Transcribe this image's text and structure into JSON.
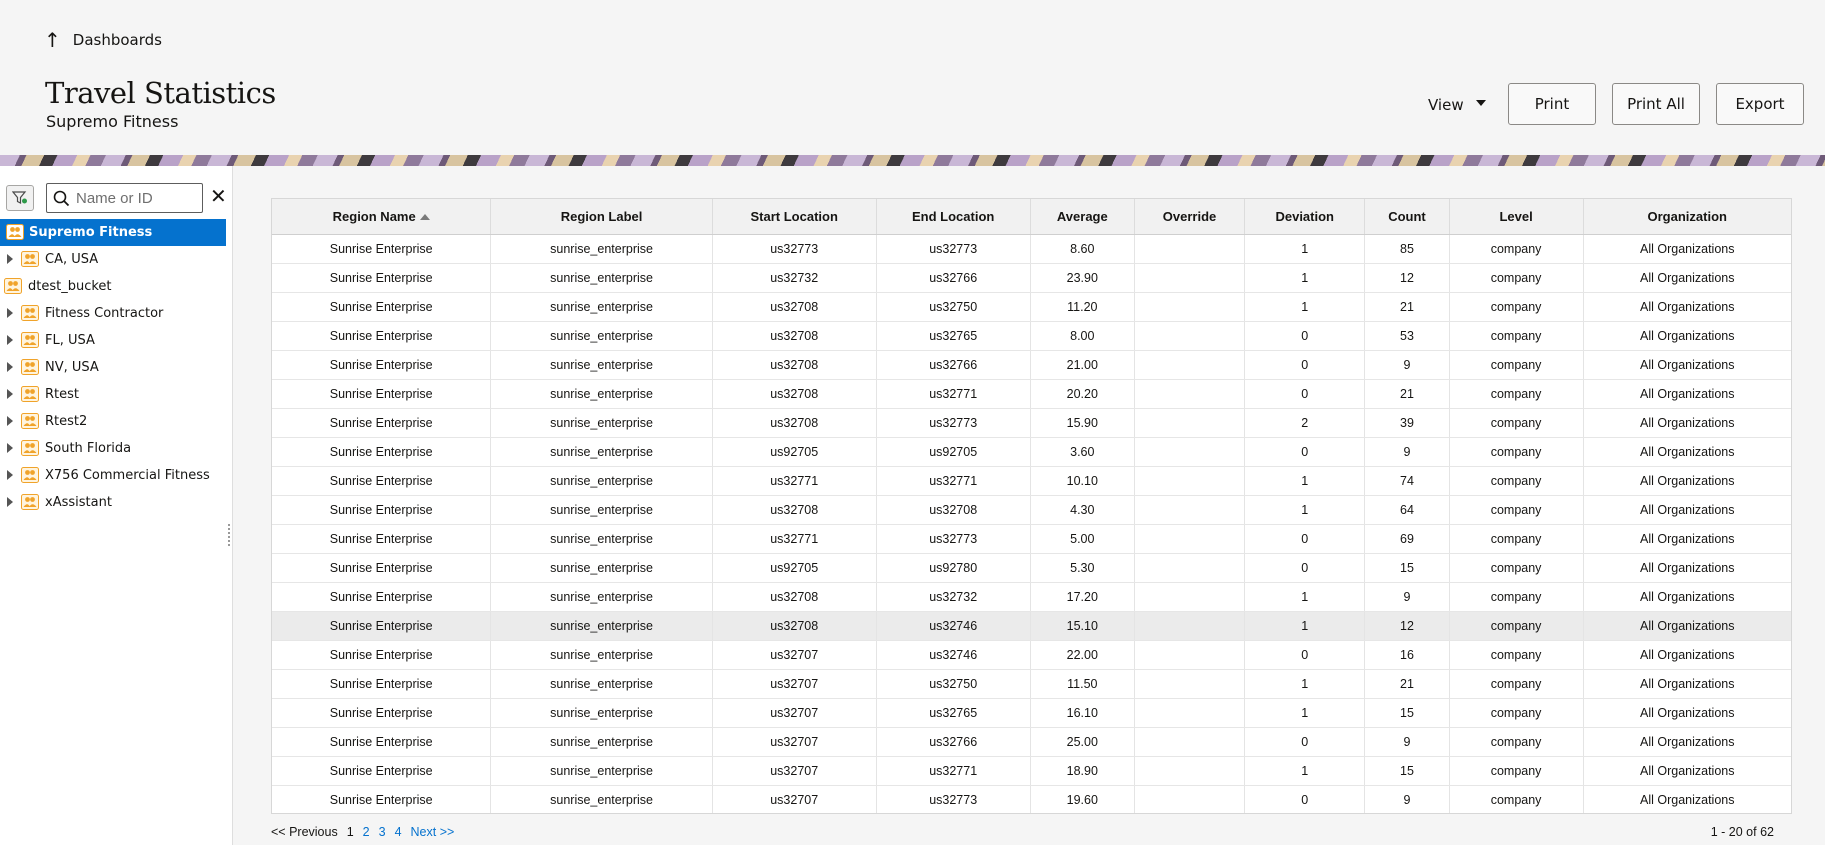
{
  "header": {
    "back_label": "Dashboards",
    "title": "Travel Statistics",
    "subtitle": "Supremo Fitness",
    "view_label": "View",
    "print_label": "Print",
    "print_all_label": "Print All",
    "export_label": "Export"
  },
  "sidebar": {
    "search_placeholder": "Name or ID",
    "items": [
      {
        "label": "Supremo Fitness"
      },
      {
        "label": "CA, USA"
      },
      {
        "label": "dtest_bucket"
      },
      {
        "label": "Fitness Contractor"
      },
      {
        "label": "FL, USA"
      },
      {
        "label": "NV, USA"
      },
      {
        "label": "Rtest"
      },
      {
        "label": "Rtest2"
      },
      {
        "label": "South Florida"
      },
      {
        "label": "X756 Commercial Fitness"
      },
      {
        "label": "xAssistant"
      }
    ]
  },
  "table": {
    "columns": [
      "Region Name",
      "Region Label",
      "Start Location",
      "End Location",
      "Average",
      "Override",
      "Deviation",
      "Count",
      "Level",
      "Organization"
    ],
    "rows": [
      [
        "Sunrise Enterprise",
        "sunrise_enterprise",
        "us32773",
        "us32773",
        "8.60",
        "",
        "1",
        "85",
        "company",
        "All Organizations"
      ],
      [
        "Sunrise Enterprise",
        "sunrise_enterprise",
        "us32732",
        "us32766",
        "23.90",
        "",
        "1",
        "12",
        "company",
        "All Organizations"
      ],
      [
        "Sunrise Enterprise",
        "sunrise_enterprise",
        "us32708",
        "us32750",
        "11.20",
        "",
        "1",
        "21",
        "company",
        "All Organizations"
      ],
      [
        "Sunrise Enterprise",
        "sunrise_enterprise",
        "us32708",
        "us32765",
        "8.00",
        "",
        "0",
        "53",
        "company",
        "All Organizations"
      ],
      [
        "Sunrise Enterprise",
        "sunrise_enterprise",
        "us32708",
        "us32766",
        "21.00",
        "",
        "0",
        "9",
        "company",
        "All Organizations"
      ],
      [
        "Sunrise Enterprise",
        "sunrise_enterprise",
        "us32708",
        "us32771",
        "20.20",
        "",
        "0",
        "21",
        "company",
        "All Organizations"
      ],
      [
        "Sunrise Enterprise",
        "sunrise_enterprise",
        "us32708",
        "us32773",
        "15.90",
        "",
        "2",
        "39",
        "company",
        "All Organizations"
      ],
      [
        "Sunrise Enterprise",
        "sunrise_enterprise",
        "us92705",
        "us92705",
        "3.60",
        "",
        "0",
        "9",
        "company",
        "All Organizations"
      ],
      [
        "Sunrise Enterprise",
        "sunrise_enterprise",
        "us32771",
        "us32771",
        "10.10",
        "",
        "1",
        "74",
        "company",
        "All Organizations"
      ],
      [
        "Sunrise Enterprise",
        "sunrise_enterprise",
        "us32708",
        "us32708",
        "4.30",
        "",
        "1",
        "64",
        "company",
        "All Organizations"
      ],
      [
        "Sunrise Enterprise",
        "sunrise_enterprise",
        "us32771",
        "us32773",
        "5.00",
        "",
        "0",
        "69",
        "company",
        "All Organizations"
      ],
      [
        "Sunrise Enterprise",
        "sunrise_enterprise",
        "us92705",
        "us92780",
        "5.30",
        "",
        "0",
        "15",
        "company",
        "All Organizations"
      ],
      [
        "Sunrise Enterprise",
        "sunrise_enterprise",
        "us32708",
        "us32732",
        "17.20",
        "",
        "1",
        "9",
        "company",
        "All Organizations"
      ],
      [
        "Sunrise Enterprise",
        "sunrise_enterprise",
        "us32708",
        "us32746",
        "15.10",
        "",
        "1",
        "12",
        "company",
        "All Organizations"
      ],
      [
        "Sunrise Enterprise",
        "sunrise_enterprise",
        "us32707",
        "us32746",
        "22.00",
        "",
        "0",
        "16",
        "company",
        "All Organizations"
      ],
      [
        "Sunrise Enterprise",
        "sunrise_enterprise",
        "us32707",
        "us32750",
        "11.50",
        "",
        "1",
        "21",
        "company",
        "All Organizations"
      ],
      [
        "Sunrise Enterprise",
        "sunrise_enterprise",
        "us32707",
        "us32765",
        "16.10",
        "",
        "1",
        "15",
        "company",
        "All Organizations"
      ],
      [
        "Sunrise Enterprise",
        "sunrise_enterprise",
        "us32707",
        "us32766",
        "25.00",
        "",
        "0",
        "9",
        "company",
        "All Organizations"
      ],
      [
        "Sunrise Enterprise",
        "sunrise_enterprise",
        "us32707",
        "us32771",
        "18.90",
        "",
        "1",
        "15",
        "company",
        "All Organizations"
      ],
      [
        "Sunrise Enterprise",
        "sunrise_enterprise",
        "us32707",
        "us32773",
        "19.60",
        "",
        "0",
        "9",
        "company",
        "All Organizations"
      ]
    ]
  },
  "pagination": {
    "previous_label": "<< Previous",
    "pages": [
      "1",
      "2",
      "3",
      "4"
    ],
    "next_label": "Next >>",
    "range_text": "1 - 20 of 62"
  },
  "colors": {
    "accent": "#0572ce",
    "org_icon": "#f0a32a"
  }
}
